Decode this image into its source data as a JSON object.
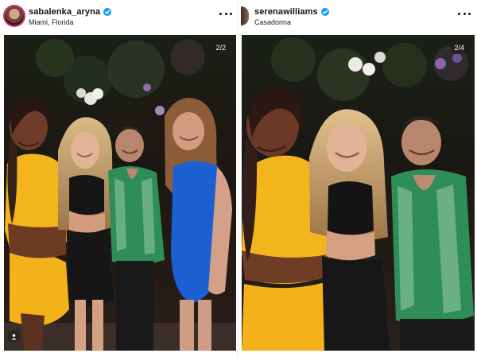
{
  "posts": [
    {
      "username": "sabalenka_aryna",
      "location": "Miami, Florida",
      "counter": "2/2",
      "verified": true
    },
    {
      "username": "serenawilliams",
      "location": "Casadonna",
      "counter": "2/4",
      "verified": true
    }
  ],
  "colors": {
    "verified": "#1d9bf0",
    "story_ring": "#d62976",
    "yellow_outfit": "#f2b51d",
    "green_shirt": "#2f8e58",
    "blue_dress": "#1b5fd1"
  },
  "icons": [
    "verified-icon",
    "more-options-icon",
    "user-tag-icon"
  ]
}
